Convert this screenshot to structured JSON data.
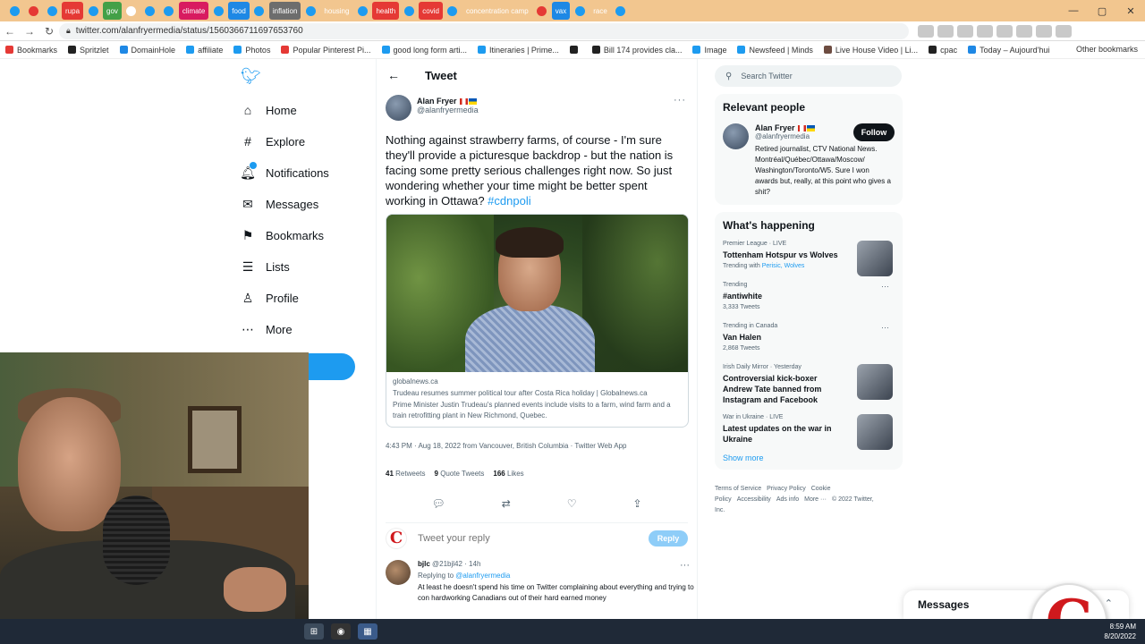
{
  "browser": {
    "tabs": [
      {
        "label": "",
        "color": "#1d9bf0"
      },
      {
        "label": "",
        "color": "#e53935"
      },
      {
        "label": "",
        "color": "#1d9bf0"
      },
      {
        "label": "rupa",
        "color": "#e53935"
      },
      {
        "label": "",
        "color": "#1d9bf0"
      },
      {
        "label": "gov",
        "color": "#43a047"
      },
      {
        "label": "",
        "color": "#ffffff"
      },
      {
        "label": "",
        "color": "#1d9bf0"
      },
      {
        "label": "",
        "color": "#1d9bf0"
      },
      {
        "label": "climate",
        "color": "#d81b60"
      },
      {
        "label": "",
        "color": "#1d9bf0"
      },
      {
        "label": "food",
        "color": "#1e88e5"
      },
      {
        "label": "",
        "color": "#1d9bf0"
      },
      {
        "label": "inflation",
        "color": "#6d6d6d"
      },
      {
        "label": "",
        "color": "#1d9bf0"
      },
      {
        "label": "housing",
        "color": "#f2c68f"
      },
      {
        "label": "",
        "color": "#1d9bf0"
      },
      {
        "label": "health",
        "color": "#e53935"
      },
      {
        "label": "",
        "color": "#1d9bf0"
      },
      {
        "label": "covid",
        "color": "#e53935"
      },
      {
        "label": "",
        "color": "#1d9bf0"
      },
      {
        "label": "concentration camp",
        "color": "#f2c68f"
      },
      {
        "label": "",
        "color": "#e53935"
      },
      {
        "label": "vax",
        "color": "#1e88e5"
      },
      {
        "label": "",
        "color": "#1d9bf0"
      },
      {
        "label": "race",
        "color": "#f2c68f"
      },
      {
        "label": "",
        "color": "#1d9bf0"
      }
    ],
    "url": "twitter.com/alanfryermedia/status/1560366711697653760",
    "bookmarks": [
      {
        "label": "Bookmarks",
        "color": "#e53935"
      },
      {
        "label": "Spritzlet",
        "color": "#222"
      },
      {
        "label": "DomainHole",
        "color": "#1e88e5"
      },
      {
        "label": "affiliate",
        "color": "#1d9bf0"
      },
      {
        "label": "Photos",
        "color": "#1d9bf0"
      },
      {
        "label": "Popular Pinterest Pi...",
        "color": "#e53935"
      },
      {
        "label": "good long form arti...",
        "color": "#1d9bf0"
      },
      {
        "label": "Itineraries | Prime...",
        "color": "#1d9bf0"
      },
      {
        "label": "",
        "color": "#222"
      },
      {
        "label": "Bill 174 provides cla...",
        "color": "#222"
      },
      {
        "label": "Image",
        "color": "#1d9bf0"
      },
      {
        "label": "Newsfeed | Minds",
        "color": "#1d9bf0"
      },
      {
        "label": "Live House Video | Li...",
        "color": "#6d4c41"
      },
      {
        "label": "cpac",
        "color": "#222"
      },
      {
        "label": "Today – Aujourd'hui",
        "color": "#1e88e5"
      }
    ],
    "other_bookmarks": "Other bookmarks"
  },
  "nav": {
    "items": [
      {
        "label": "Home",
        "icon": "⌂"
      },
      {
        "label": "Explore",
        "icon": "#"
      },
      {
        "label": "Notifications",
        "icon": "🔔︎"
      },
      {
        "label": "Messages",
        "icon": "✉"
      },
      {
        "label": "Bookmarks",
        "icon": "⚑"
      },
      {
        "label": "Lists",
        "icon": "☰"
      },
      {
        "label": "Profile",
        "icon": "♙"
      },
      {
        "label": "More",
        "icon": "⋯"
      }
    ]
  },
  "main": {
    "title": "Tweet",
    "tweet": {
      "author_name": "Alan Fryer",
      "author_handle": "@alanfryermedia",
      "text": "Nothing against strawberry farms, of course - I'm sure they'll provide a picturesque backdrop -  but the nation is facing some pretty serious challenges right now. So just wondering whether your time might be better spent working in Ottawa? ",
      "hashtag": "#cdnpoli",
      "card_domain": "globalnews.ca",
      "card_title": "Trudeau resumes summer political tour after Costa Rica holiday | Globalnews.ca",
      "card_desc": "Prime Minister Justin Trudeau's planned events include visits to a farm, wind farm and a train retrofitting plant in New Richmond, Quebec.",
      "timestamp": "4:43 PM · Aug 18, 2022 from Vancouver, British Columbia · Twitter Web App",
      "retweets": "41",
      "retweets_label": "Retweets",
      "quotes": "9",
      "quotes_label": "Quote Tweets",
      "likes": "166",
      "likes_label": "Likes"
    },
    "reply_placeholder": "Tweet your reply",
    "reply_button": "Reply",
    "reply": {
      "name": "bjlc",
      "handle": "@21bjl42 · 14h",
      "replying_prefix": "Replying to",
      "replying_to": "@alanfryermedia",
      "text": "At least he doesn't spend his time on Twitter complaining about everything and trying to con hardworking Canadians out of their hard earned money"
    }
  },
  "sidebar": {
    "search_placeholder": "Search Twitter",
    "relevant_title": "Relevant people",
    "person": {
      "name": "Alan Fryer",
      "handle": "@alanfryermedia",
      "bio": "Retired journalist, CTV National News. Montréal/Québec/Ottawa/Moscow/ Washington/Toronto/W5. Sure I won awards but, really, at this point who gives a shit?",
      "follow": "Follow"
    },
    "happening_title": "What's happening",
    "trends": [
      {
        "meta": "Premier League · LIVE",
        "title": "Tottenham Hotspur vs Wolves",
        "sub": "Trending with ",
        "sub_links": "Perisic, Wolves",
        "thumb": true
      },
      {
        "meta": "Trending",
        "title": "#antiwhite",
        "sub": "3,333 Tweets",
        "sub_links": "",
        "thumb": false
      },
      {
        "meta": "Trending in Canada",
        "title": "Van Halen",
        "sub": "2,868 Tweets",
        "sub_links": "",
        "thumb": false
      },
      {
        "meta": "Irish Daily Mirror · Yesterday",
        "title": "Controversial kick-boxer Andrew Tate banned from Instagram and Facebook",
        "sub": "",
        "sub_links": "",
        "thumb": true
      },
      {
        "meta": "War in Ukraine · LIVE",
        "title": "Latest updates on the war in Ukraine",
        "sub": "",
        "sub_links": "",
        "thumb": true
      }
    ],
    "show_more": "Show more",
    "footer": [
      "Terms of Service",
      "Privacy Policy",
      "Cookie Policy",
      "Accessibility",
      "Ads info",
      "More ···",
      "© 2022 Twitter, Inc."
    ]
  },
  "messages_drawer": "Messages",
  "c_logo": "C",
  "reply_avatar_letter": "C",
  "taskbar": {
    "time": "8:59 AM",
    "date": "8/20/2022"
  }
}
